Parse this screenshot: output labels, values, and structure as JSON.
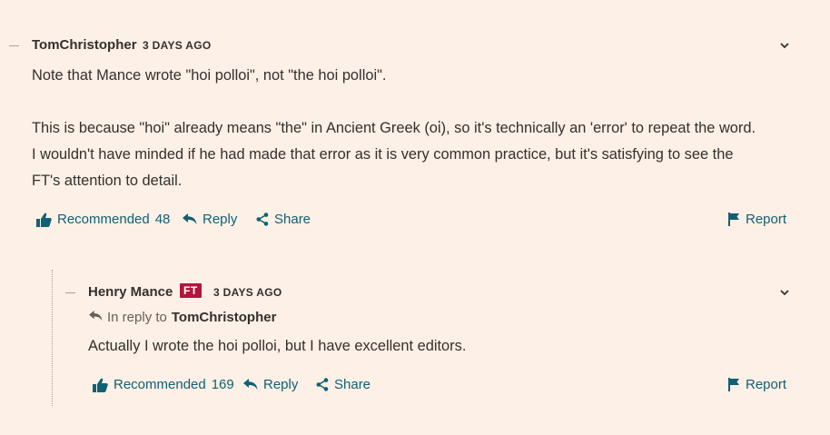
{
  "comment": {
    "author": "TomChristopher",
    "timestamp": "3 DAYS AGO",
    "paragraph1": "Note that Mance wrote \"hoi polloi\", not \"the hoi polloi\".",
    "paragraph2_lines": [
      "This is because \"hoi\" already means \"the\" in Ancient Greek (οἱ), so it's technically an 'error' to repeat the word.",
      "I wouldn't have minded if he had made that error as it is very common practice, but it's satisfying to see the",
      "FT's attention to detail."
    ],
    "actions": {
      "recommended_label": "Recommended",
      "recommended_count": "48",
      "reply": "Reply",
      "share": "Share",
      "report": "Report"
    }
  },
  "reply": {
    "author": "Henry Mance",
    "badge": "FT",
    "timestamp": "3 DAYS AGO",
    "in_reply_to_label": "In reply to",
    "in_reply_to_author": "TomChristopher",
    "text": "Actually I wrote the hoi polloi, but I have excellent editors.",
    "actions": {
      "recommended_label": "Recommended",
      "recommended_count": "169",
      "reply": "Reply",
      "share": "Share",
      "report": "Report"
    }
  },
  "colors": {
    "background": "#fdf0e6",
    "link": "#0f6175",
    "badge": "#b0163d",
    "text": "#33302e"
  },
  "icons": [
    "collapse-dash-icon",
    "chevron-down-icon",
    "thumbs-up-icon",
    "reply-arrow-icon",
    "share-icon",
    "flag-icon"
  ]
}
